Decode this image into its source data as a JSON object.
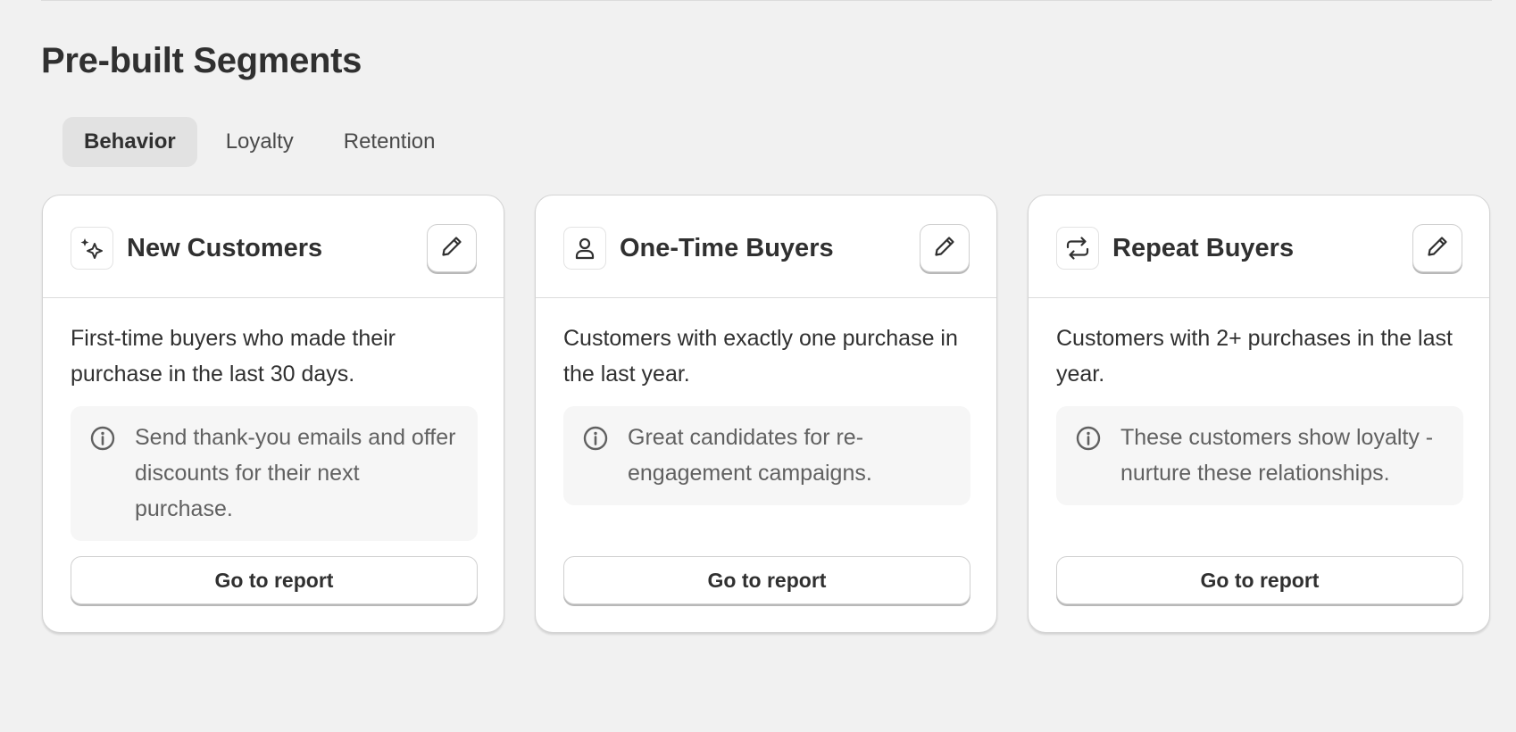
{
  "page": {
    "title": "Pre-built Segments"
  },
  "tabs": [
    {
      "label": "Behavior",
      "active": true
    },
    {
      "label": "Loyalty",
      "active": false
    },
    {
      "label": "Retention",
      "active": false
    }
  ],
  "cards": [
    {
      "icon": "sparkle-icon",
      "title": "New Customers",
      "description": "First-time buyers who made their purchase in the last 30 days.",
      "note": "Send thank-you emails and offer discounts for their next purchase.",
      "button_label": "Go to report"
    },
    {
      "icon": "person-icon",
      "title": "One-Time Buyers",
      "description": "Customers with exactly one purchase in the last year.",
      "note": "Great candidates for re-engagement campaigns.",
      "button_label": "Go to report"
    },
    {
      "icon": "repeat-icon",
      "title": "Repeat Buyers",
      "description": "Customers with 2+ purchases in the last year.",
      "note": "These customers show loyalty - nurture these relationships.",
      "button_label": "Go to report"
    }
  ],
  "colors": {
    "background": "#f1f1f1",
    "card": "#ffffff",
    "text": "#303030",
    "muted_text": "#616161",
    "active_tab": "#e2e2e2",
    "note_background": "#f6f6f6"
  }
}
